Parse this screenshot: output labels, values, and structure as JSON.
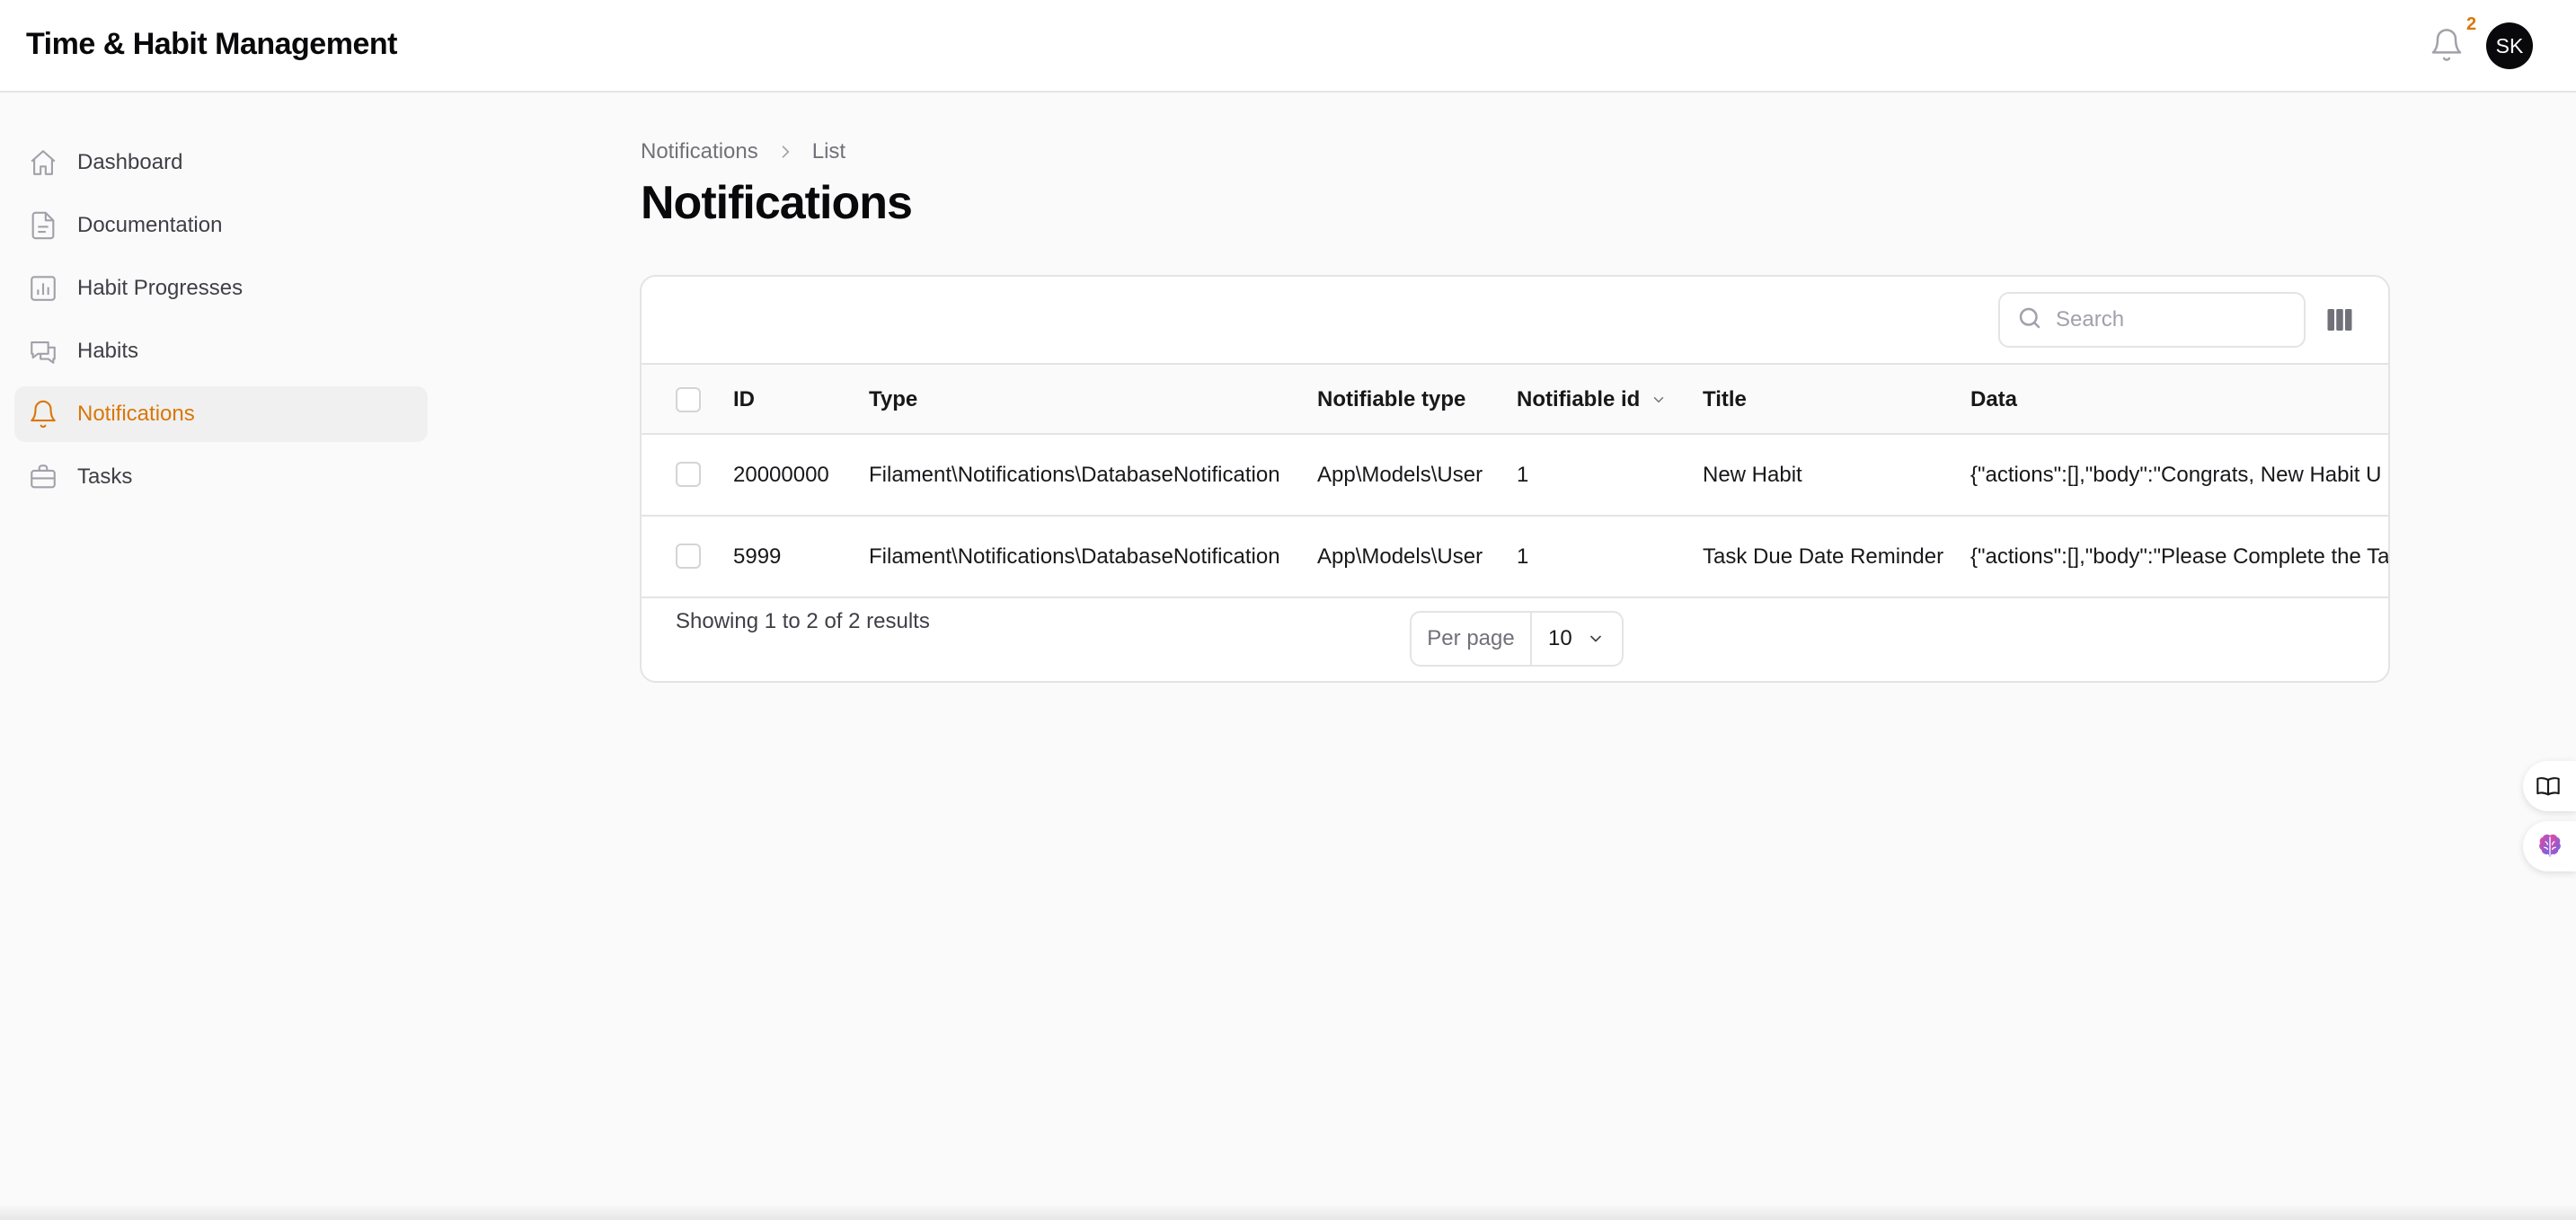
{
  "app": {
    "title": "Time & Habit Management"
  },
  "header": {
    "notification_count": "2",
    "avatar_initials": "SK"
  },
  "sidebar": {
    "items": [
      {
        "label": "Dashboard",
        "icon": "home-icon"
      },
      {
        "label": "Documentation",
        "icon": "document-icon"
      },
      {
        "label": "Habit Progresses",
        "icon": "chart-bar-icon"
      },
      {
        "label": "Habits",
        "icon": "chat-bubbles-icon"
      },
      {
        "label": "Notifications",
        "icon": "bell-icon",
        "active": true
      },
      {
        "label": "Tasks",
        "icon": "briefcase-icon"
      }
    ]
  },
  "breadcrumb": {
    "parent": "Notifications",
    "current": "List"
  },
  "page": {
    "title": "Notifications"
  },
  "search": {
    "placeholder": "Search"
  },
  "table": {
    "columns": {
      "id": "ID",
      "type": "Type",
      "notifiable_type": "Notifiable type",
      "notifiable_id": "Notifiable id",
      "title": "Title",
      "data": "Data"
    },
    "rows": [
      {
        "id": "20000000",
        "type": "Filament\\Notifications\\DatabaseNotification",
        "notifiable_type": "App\\Models\\User",
        "notifiable_id": "1",
        "title": "New Habit",
        "data": "{\"actions\":[],\"body\":\"Congrats, New Habit U"
      },
      {
        "id": "5999",
        "type": "Filament\\Notifications\\DatabaseNotification",
        "notifiable_type": "App\\Models\\User",
        "notifiable_id": "1",
        "title": "Task Due Date Reminder",
        "data": "{\"actions\":[],\"body\":\"Please Complete the Ta"
      }
    ]
  },
  "pagination": {
    "summary": "Showing 1 to 2 of 2 results",
    "per_page_label": "Per page",
    "per_page_value": "10"
  },
  "colors": {
    "accent": "#d97706",
    "text": "#18181b",
    "border": "#e4e4e7"
  }
}
